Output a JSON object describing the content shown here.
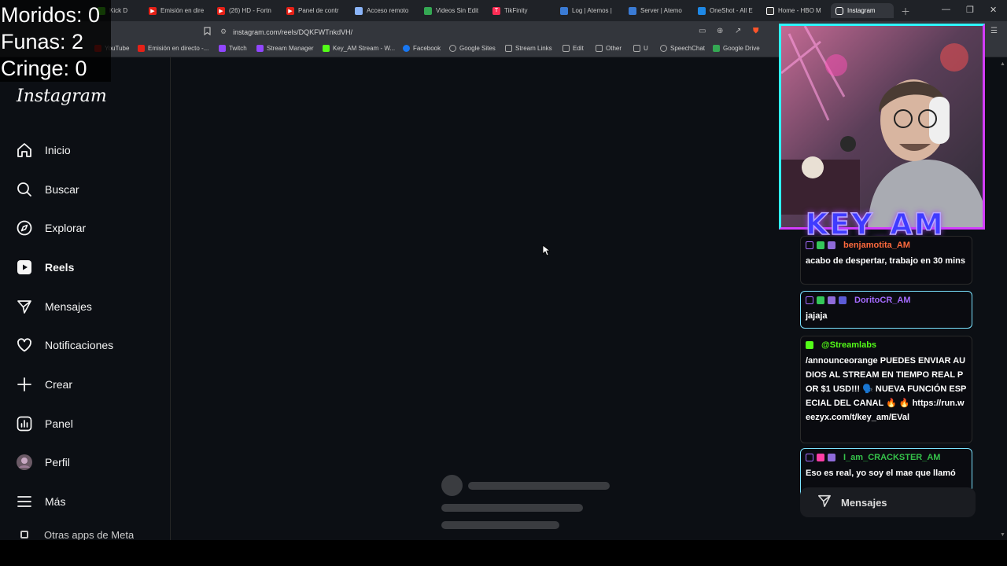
{
  "browser": {
    "tabs": [
      {
        "label": "Kick D",
        "color": "#53fc18"
      },
      {
        "label": "Emisión en dire",
        "color": "#e62117"
      },
      {
        "label": "(26) HD - Fortn",
        "color": "#e62117"
      },
      {
        "label": "Panel de contr",
        "color": "#e62117"
      },
      {
        "label": "Acceso remoto",
        "color": "#8ab4f8"
      },
      {
        "label": "Videos Sin Edit",
        "color": "#34a853"
      },
      {
        "label": "TikFinity",
        "color": "#ff2d55"
      },
      {
        "label": "Log | Atemos |",
        "color": "#3a7bd5"
      },
      {
        "label": "Server | Atemo",
        "color": "#3a7bd5"
      },
      {
        "label": "OneShot - All E",
        "color": "#1e88e5"
      },
      {
        "label": "Home - HBO M",
        "color": "#ffffff"
      },
      {
        "label": "Instagram",
        "color": "#ffffff"
      }
    ],
    "url": "instagram.com/reels/DQKFWTnkdVH/",
    "bookmarks": [
      {
        "label": "YouTube",
        "color": "#e62117"
      },
      {
        "label": "Emisión en directo -...",
        "color": "#e62117"
      },
      {
        "label": "Twitch",
        "color": "#9146ff"
      },
      {
        "label": "Stream Manager",
        "color": "#9146ff"
      },
      {
        "label": "Key_AM Stream - W...",
        "color": "#53fc18"
      },
      {
        "label": "Facebook",
        "color": "#1877f2"
      },
      {
        "label": "Google Sites",
        "color": "#aaaaaa"
      },
      {
        "label": "Stream Links",
        "color": "#aaaaaa"
      },
      {
        "label": "Edit",
        "color": "#aaaaaa"
      },
      {
        "label": "Other",
        "color": "#aaaaaa"
      },
      {
        "label": "U",
        "color": "#aaaaaa"
      },
      {
        "label": "SpeechChat",
        "color": "#aaaaaa"
      },
      {
        "label": "Google Drive",
        "color": "#34a853"
      }
    ]
  },
  "counters": {
    "moridos": "Moridos: 0",
    "funas": "Funas: 2",
    "cringe": "Cringe: 0"
  },
  "instagram": {
    "logo": "Instagram",
    "nav": [
      {
        "label": "Inicio",
        "icon": "home-icon"
      },
      {
        "label": "Buscar",
        "icon": "search-icon"
      },
      {
        "label": "Explorar",
        "icon": "compass-icon"
      },
      {
        "label": "Reels",
        "icon": "reels-icon"
      },
      {
        "label": "Mensajes",
        "icon": "send-icon"
      },
      {
        "label": "Notificaciones",
        "icon": "heart-icon"
      },
      {
        "label": "Crear",
        "icon": "plus-icon"
      },
      {
        "label": "Panel",
        "icon": "chart-icon"
      },
      {
        "label": "Perfil",
        "icon": "avatar-icon"
      },
      {
        "label": "Más",
        "icon": "menu-icon"
      }
    ],
    "nav_cut": "Otras apps de Meta",
    "messages_box": "Mensajes"
  },
  "stream": {
    "brand": "KEY_AM",
    "chat": [
      {
        "user": "benjamotita_AM",
        "color": "#ff6a3d",
        "message": "acabo de despertar, trabajo en 30 mins"
      },
      {
        "user": "DoritoCR_AM",
        "color": "#a56bff",
        "message": "jajaja"
      },
      {
        "user": "@Streamlabs",
        "color": "#53fc18",
        "message": "/announceorange PUEDES ENVIAR AUDIOS AL STREAM EN TIEMPO REAL POR $1 USD!!! 🗣️ NUEVA FUNCIÓN ESPECIAL DEL CANAL 🔥 🔥 https://run.weezyx.com/t/key_am/EVal"
      },
      {
        "user": "I_am_CRACKSTER_AM",
        "color": "#35c24a",
        "message": "Eso es real, yo soy el mae que llamó"
      }
    ]
  }
}
